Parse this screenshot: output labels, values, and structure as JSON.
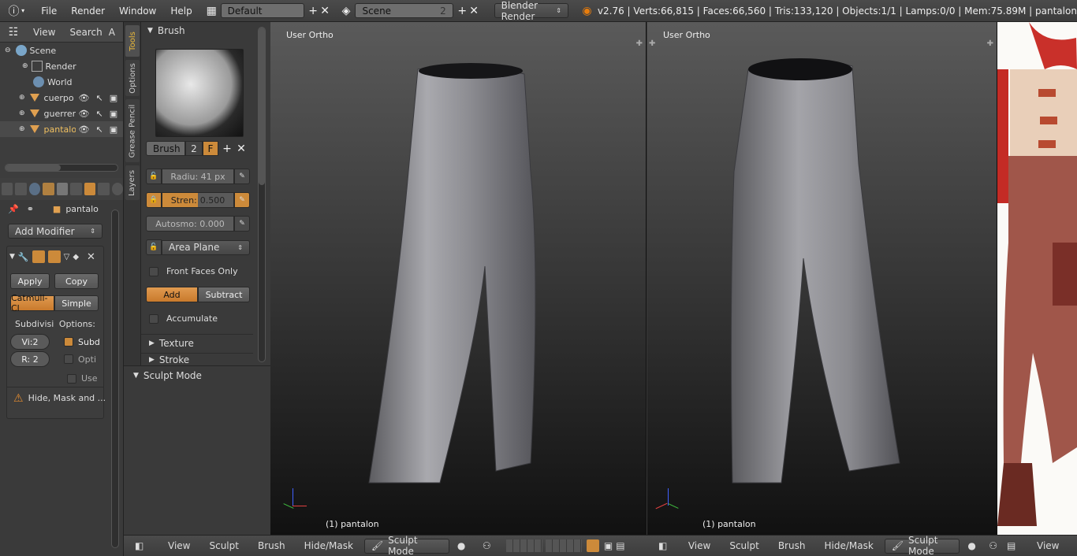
{
  "topbar": {
    "menus": [
      "File",
      "Render",
      "Window",
      "Help"
    ],
    "screen_layout": "Default",
    "scene": "Scene",
    "scene_users": "2",
    "render_engine": "Blender Render",
    "stats": "v2.76 | Verts:66,815 | Faces:66,560 | Tris:133,120 | Objects:1/1 | Lamps:0/0 | Mem:75.89M | pantalon"
  },
  "outliner": {
    "header": {
      "view": "View",
      "search": "Search",
      "tab": "A"
    },
    "items": [
      {
        "label": "Scene"
      },
      {
        "label": "Render"
      },
      {
        "label": "World"
      },
      {
        "label": "cuerpo"
      },
      {
        "label": "guerrer"
      },
      {
        "label": "pantalo"
      }
    ]
  },
  "properties": {
    "object_name": "pantalo",
    "add_modifier": "Add Modifier",
    "apply": "Apply",
    "copy": "Copy",
    "catmull": "Catmull-Cl",
    "simple": "Simple",
    "subdivisions_label": "Subdivisi",
    "options_label": "Options:",
    "view_levels": "Vi:2",
    "render_levels": "R: 2",
    "opt_subd": "Subd",
    "opt_opti": "Opti",
    "opt_use": "Use",
    "warning": "Hide, Mask and ..."
  },
  "tool_tabs": [
    "Tools",
    "Options",
    "Grease Pencil",
    "Layers"
  ],
  "tools": {
    "brush_header": "Brush",
    "brush_name": "Brush",
    "brush_users": "2",
    "brush_fake": "F",
    "radius": "Radiu: 41 px",
    "strength_label": "Stren:",
    "strength_value": "0.500",
    "autosmooth": "Autosmo: 0.000",
    "area_plane": "Area Plane",
    "front_faces": "Front Faces Only",
    "add": "Add",
    "subtract": "Subtract",
    "accumulate": "Accumulate",
    "texture": "Texture",
    "stroke": "Stroke",
    "sculpt_mode_panel": "Sculpt Mode"
  },
  "viewport_left": {
    "label": "User Ortho",
    "object": "(1) pantalon",
    "footer": [
      "View",
      "Sculpt",
      "Brush",
      "Hide/Mask"
    ],
    "mode": "Sculpt Mode"
  },
  "viewport_right": {
    "label": "User Ortho",
    "object": "(1) pantalon",
    "footer": [
      "View",
      "Sculpt",
      "Brush",
      "Hide/Mask"
    ],
    "mode": "Sculpt Mode"
  },
  "image_editor": {
    "footer_view": "View"
  },
  "colors": {
    "accent": "#cc8a3a",
    "selected_text": "#f0c060"
  }
}
